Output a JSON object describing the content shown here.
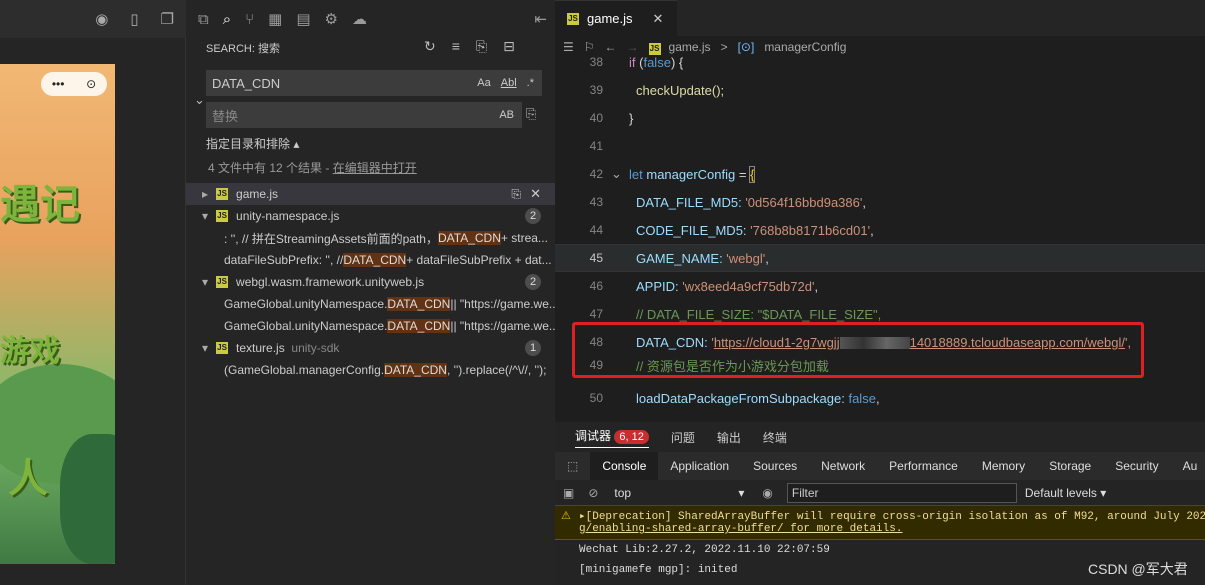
{
  "simulator": {
    "game_title_1": "遇记",
    "game_title_2": "游戏",
    "game_title_3": "人",
    "capsule_more": "•••"
  },
  "search": {
    "header": "SEARCH: 搜索",
    "query": "DATA_CDN",
    "replace_placeholder": "替换",
    "case_label": "Aa",
    "word_label": "Abl",
    "regex_label": ".*",
    "preserve_case_label": "AB",
    "include_exclude": "指定目录和排除",
    "summary_prefix": "4 文件中有 12 个结果 - ",
    "open_in_editor": "在编辑器中打开",
    "results": [
      {
        "file": "game.js",
        "dir": "",
        "count": ""
      },
      {
        "file": "unity-namespace.js",
        "dir": "",
        "count": "2",
        "matches": [
          {
            "pre": ": '', // 拼在StreamingAssets前面的path，",
            "hit": "DATA_CDN",
            "post": " + strea..."
          },
          {
            "pre": "dataFileSubPrefix: '', // ",
            "hit": "DATA_CDN",
            "post": " + dataFileSubPrefix + dat..."
          }
        ]
      },
      {
        "file": "webgl.wasm.framework.unityweb.js",
        "dir": "",
        "count": "2",
        "matches": [
          {
            "pre": "GameGlobal.unityNamespace.",
            "hit": "DATA_CDN",
            "post": " || \"https://game.we..."
          },
          {
            "pre": "GameGlobal.unityNamespace.",
            "hit": "DATA_CDN",
            "post": " || \"https://game.we..."
          }
        ]
      },
      {
        "file": "texture.js",
        "dir": "unity-sdk",
        "count": "1",
        "matches": [
          {
            "pre": "(GameGlobal.managerConfig.",
            "hit": "DATA_CDN",
            "post": ", '').replace(/^\\//, '');"
          }
        ]
      }
    ]
  },
  "editor": {
    "tab_label": "game.js",
    "breadcrumb_file": "game.js",
    "breadcrumb_symbol": "managerConfig",
    "lines": [
      {
        "n": "38",
        "t": "if (false) {"
      },
      {
        "n": "39",
        "t": "checkUpdate();"
      },
      {
        "n": "40",
        "t": "}"
      },
      {
        "n": "41",
        "t": ""
      },
      {
        "n": "42",
        "t": "let managerConfig = {"
      },
      {
        "n": "43",
        "key": "DATA_FILE_MD5: ",
        "val": "'0d564f16bbd9a386'",
        "end": ","
      },
      {
        "n": "44",
        "key": "CODE_FILE_MD5: ",
        "val": "'768b8b8171b6cd01'",
        "end": ","
      },
      {
        "n": "45",
        "key": "GAME_NAME: ",
        "val": "'webgl'",
        "end": ","
      },
      {
        "n": "46",
        "key": "APPID: ",
        "val": "'wx8eed4a9cf75db72d'",
        "end": ","
      },
      {
        "n": "47",
        "t": "// DATA_FILE_SIZE: \"$DATA_FILE_SIZE\","
      },
      {
        "n": "48",
        "key": "DATA_CDN: ",
        "url_a": "https://cloud1-2g7wgjj",
        "url_b": "14018889.tcloudbaseapp.com/webgl/",
        "end": "',"
      },
      {
        "n": "49",
        "t": "// 资源包是否作为小游戏分包加载"
      },
      {
        "n": "50",
        "key": "loadDataPackageFromSubpackage: ",
        "val": "false",
        "end": ","
      }
    ]
  },
  "devtools": {
    "tabs": [
      "调试器",
      "问题",
      "输出",
      "终端"
    ],
    "error_badge": "6, 12",
    "chrome_tabs": [
      "Console",
      "Application",
      "Sources",
      "Network",
      "Performance",
      "Memory",
      "Storage",
      "Security",
      "Au"
    ],
    "context": "top",
    "filter_placeholder": "Filter",
    "levels": "Default levels",
    "messages": [
      "▸[Deprecation] SharedArrayBuffer will require cross-origin isolation as of M92, around July 202",
      "g/enabling-shared-array-buffer/ for more details.",
      "Wechat Lib:2.27.2, 2022.11.10 22:07:59",
      "[minigamefe mgp]: inited"
    ]
  },
  "watermark": "CSDN @军大君",
  "colors": {
    "highlight_box": "#e02020",
    "accent": "#0e639c"
  }
}
